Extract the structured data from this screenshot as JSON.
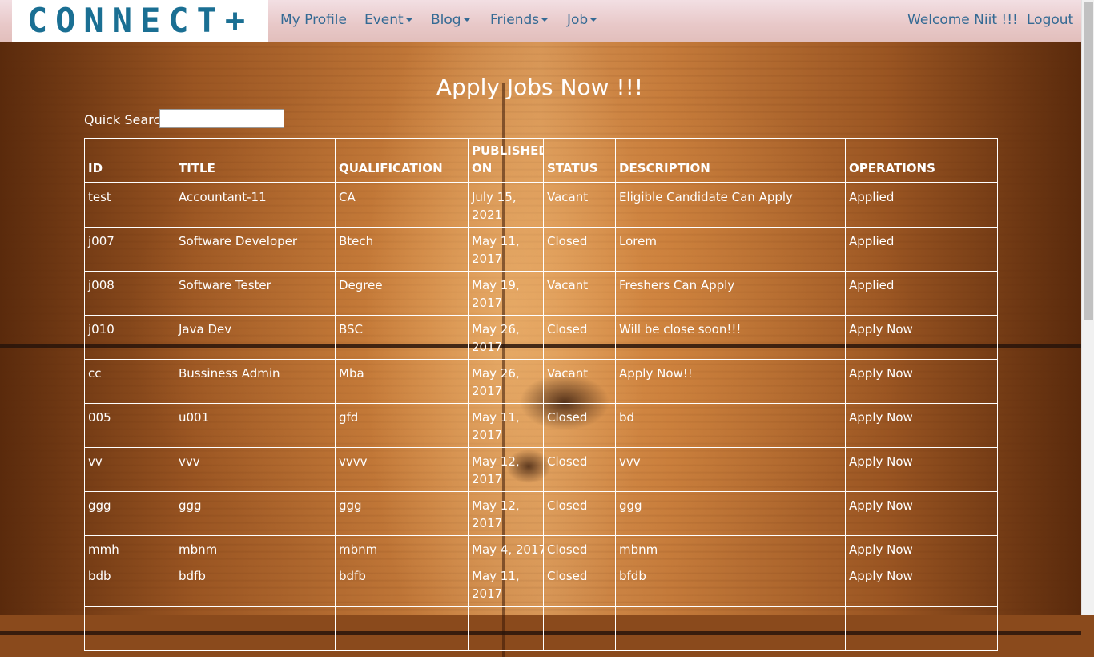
{
  "nav": {
    "logo": "CONNECT+",
    "items": [
      {
        "label": "My Profile",
        "dropdown": false
      },
      {
        "label": "Event",
        "dropdown": true
      },
      {
        "label": "Blog",
        "dropdown": true
      },
      {
        "label": "Friends",
        "dropdown": true
      },
      {
        "label": "Job",
        "dropdown": true
      }
    ],
    "welcome": "Welcome Niit !!!",
    "logout": "Logout"
  },
  "page": {
    "title": "Apply Jobs Now !!!",
    "search_label": "Quick Search:",
    "search_value": ""
  },
  "table": {
    "headers": [
      "ID",
      "TITLE",
      "QUALIFICATION",
      "PUBLISHED ON",
      "STATUS",
      "DESCRIPTION",
      "OPERATIONS"
    ],
    "rows": [
      {
        "id": "test",
        "title": "Accountant-11",
        "qualification": "CA",
        "published": "July 15, 2021",
        "status": "Vacant",
        "description": "Eligible Candidate Can Apply",
        "operation": "Applied"
      },
      {
        "id": "j007",
        "title": "Software Developer",
        "qualification": "Btech",
        "published": "May 11, 2017",
        "status": "Closed",
        "description": "Lorem",
        "operation": "Applied"
      },
      {
        "id": "j008",
        "title": "Software Tester",
        "qualification": "Degree",
        "published": "May 19, 2017",
        "status": "Vacant",
        "description": "Freshers Can Apply",
        "operation": "Applied"
      },
      {
        "id": "j010",
        "title": "Java Dev",
        "qualification": "BSC",
        "published": "May 26, 2017",
        "status": "Closed",
        "description": "Will be close soon!!!",
        "operation": "Apply Now"
      },
      {
        "id": "cc",
        "title": "Bussiness Admin",
        "qualification": "Mba",
        "published": "May 26, 2017",
        "status": "Vacant",
        "description": "Apply Now!!",
        "operation": "Apply Now"
      },
      {
        "id": "005",
        "title": "u001",
        "qualification": "gfd",
        "published": "May 11, 2017",
        "status": "Closed",
        "description": "bd",
        "operation": "Apply Now"
      },
      {
        "id": "vv",
        "title": "vvv",
        "qualification": "vvvv",
        "published": "May 12, 2017",
        "status": "Closed",
        "description": "vvv",
        "operation": "Apply Now"
      },
      {
        "id": "ggg",
        "title": "ggg",
        "qualification": "ggg",
        "published": "May 12, 2017",
        "status": "Closed",
        "description": "ggg",
        "operation": "Apply Now"
      },
      {
        "id": "mmh",
        "title": "mbnm",
        "qualification": "mbnm",
        "published": "May 4, 2017",
        "status": "Closed",
        "description": "mbnm",
        "operation": "Apply Now"
      },
      {
        "id": "bdb",
        "title": "bdfb",
        "qualification": "bdfb",
        "published": "May 11, 2017",
        "status": "Closed",
        "description": "bfdb",
        "operation": "Apply Now"
      },
      {
        "id": "",
        "title": "",
        "qualification": "",
        "published": "",
        "status": "",
        "description": "",
        "operation": ""
      }
    ]
  }
}
